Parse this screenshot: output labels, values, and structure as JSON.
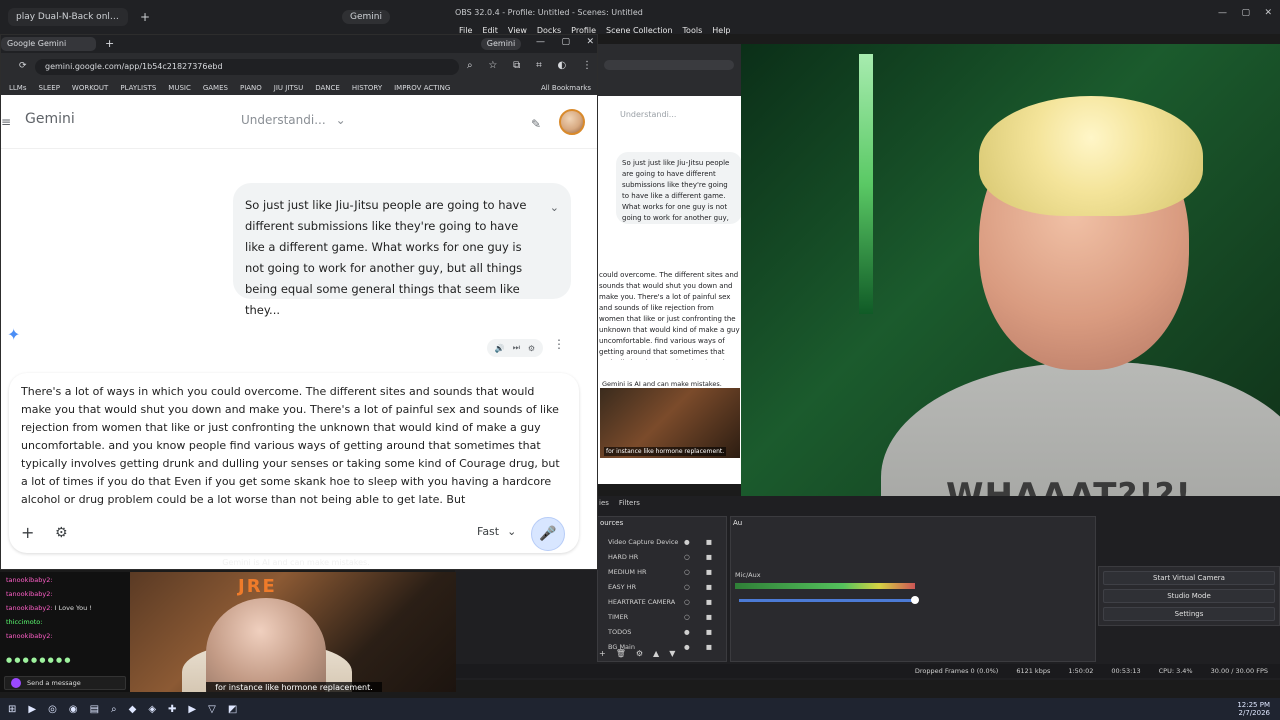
{
  "top_browser": {
    "tab_title": "play Dual-N-Back online | Nba",
    "new_tab": "+",
    "gemini_chip": "Gemini"
  },
  "obs": {
    "title": "OBS 32.0.4 - Profile: Untitled - Scenes: Untitled",
    "menu": [
      "File",
      "Edit",
      "View",
      "Docks",
      "Profile",
      "Scene Collection",
      "Tools",
      "Help"
    ],
    "window_controls": [
      "—",
      "▢",
      "✕"
    ],
    "dock_tabs": [
      "ies",
      "Filters"
    ],
    "sources_title": "ources",
    "sources": [
      "Video Capture Device",
      "HARD HR",
      "MEDIUM HR",
      "EASY HR",
      "HEARTRATE CAMERA",
      "TIMER",
      "TODOS",
      "BG Main"
    ],
    "audio_title": "Au",
    "mic_label": "Mic/Aux",
    "controls": {
      "start_virtual_camera": "Start Virtual Camera",
      "studio_mode": "Studio Mode",
      "settings": "Settings"
    },
    "status": {
      "dropped_frames": "Dropped Frames 0 (0.0%)",
      "bitrate": "6121 kbps",
      "live": "1:50:02",
      "rec": "00:53:13",
      "cpu": "CPU: 3.4%",
      "fps": "30.00 / 30.00 FPS"
    }
  },
  "browser": {
    "tab_title": "Google Gemini",
    "new_tab": "+",
    "gemini_chip": "Gemini",
    "window_controls": [
      "—",
      "▢",
      "✕"
    ],
    "url": "gemini.google.com/app/1b54c21827376ebd",
    "bookmarks": [
      "LLMs",
      "SLEEP",
      "WORKOUT",
      "PLAYLISTS",
      "MUSIC",
      "GAMES",
      "PIANO",
      "JIU JITSU",
      "DANCE",
      "HISTORY",
      "IMPROV ACTING"
    ],
    "all_bookmarks": "All Bookmarks"
  },
  "gemini": {
    "brand": "Gemini",
    "model_pill": "Understandi...",
    "user_message": "So just just like Jiu-Jitsu people are going to have different submissions like they're going to have like a different game. What works for one guy is not going to work for another guy, but all things being equal some general things that seem like they...",
    "response_text": "There's a lot of ways in which you could overcome. The different sites and sounds that would make you that would shut you down and make you. There's a lot of painful sex and sounds of like rejection from women that like or just confronting the unknown that would kind of make a guy uncomfortable. and you know people find various ways of getting around that sometimes that typically involves getting drunk and dulling your senses or taking some kind of Courage drug, but a lot of times if you do that Even if you get some skank hoe to sleep with you having a hardcore alcohol or drug problem could be a lot worse than not being able to get late. But",
    "composer": {
      "plus": "+",
      "tools": "⚙",
      "speed_mode": "Fast",
      "mic": "🎤"
    },
    "disclaimer": "Gemini is AI and can make mistakes."
  },
  "obs_preview": {
    "model_pill": "Understandi...",
    "user_message": "So just just like Jiu-Jitsu people are going to have different submissions like they're going to have like a different game. What works for one guy is not going to work for another guy, but all things being equal some general things that seem",
    "response_text": "could overcome. The different sites and sounds that would shut you down and make you. There's a lot of painful sex and sounds of like rejection from women that like or just confronting the unknown that would kind of make a guy uncomfortable. find various ways of getting around that sometimes that typically involves getting drunk and dulling your senses or taking some kind of Courage drug, but a lot of times if you do that Even if you get some skank hoe to sleep with you having a hardcore alcohol or drug problem could be a lot worse than not being able to get late. But",
    "disclaimer": "Gemini is AI and can make mistakes.",
    "caption": "for instance like hormone replacement."
  },
  "chat": {
    "lines": [
      {
        "name": "tanookibaby2:",
        "text": ""
      },
      {
        "name": "tanookibaby2:",
        "text": ""
      },
      {
        "name": "tanookibaby2:",
        "text": "I Love You !"
      },
      {
        "name": "thiccimoto:",
        "text": ""
      },
      {
        "name": "tanookibaby2:",
        "text": ""
      }
    ],
    "input_placeholder": "Send a message"
  },
  "video_overlay": {
    "logo": "JRE",
    "caption": "for instance like hormone replacement."
  },
  "webcam": {
    "shirt_text": "WHAAAT?!?!"
  },
  "taskbar": {
    "time": "12:25 PM",
    "date": "2/7/2026"
  },
  "colors": {
    "gemini_accent": "#4b8ef5",
    "obs_bg": "#1f1f22",
    "webcam_green": "#1b5b2d"
  }
}
